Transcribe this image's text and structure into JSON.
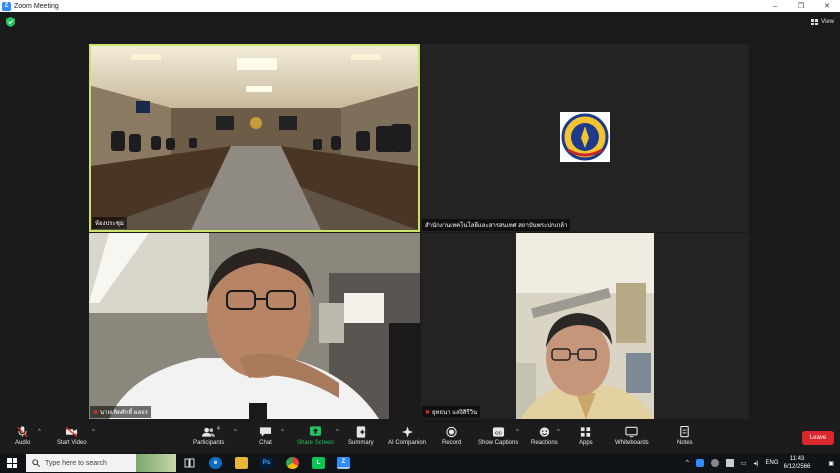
{
  "window": {
    "title": "Zoom Meeting",
    "controls": [
      "–",
      "❐",
      "✕"
    ]
  },
  "top_bar": {
    "view_label": "View"
  },
  "participants_tiles": [
    {
      "name": "ห้องประชุม",
      "muted": false,
      "active_speaker": true
    },
    {
      "name": "สำนักงานเทคโนโลยีและสารสนเทศ สถาบันพระปกเกล้า",
      "muted": false,
      "active_speaker": false
    },
    {
      "name": "นายเทิดศักดิ์ ผลจร",
      "muted": true,
      "active_speaker": false
    },
    {
      "name": "ยุทธนา แสงิสิรีวิน",
      "muted": true,
      "active_speaker": false
    }
  ],
  "toolbar": {
    "audio": "Audio",
    "start_video": "Start Video",
    "participants": "Participants",
    "participants_count": "4",
    "chat": "Chat",
    "share_screen": "Share Screen",
    "summary": "Summary",
    "ai_companion": "AI Companion",
    "record": "Record",
    "show_captions": "Show Captions",
    "reactions": "Reactions",
    "apps": "Apps",
    "whiteboards": "Whiteboards",
    "notes": "Notes",
    "leave": "Leave"
  },
  "taskbar": {
    "search_placeholder": "Type here to search",
    "language": "ENG",
    "time": "11:43",
    "date": "6/12/2566"
  },
  "colors": {
    "active_speaker_border": "#c9e36b",
    "share_green": "#22c55e",
    "leave_red": "#d9282d",
    "zoom_blue": "#2d8cff"
  }
}
